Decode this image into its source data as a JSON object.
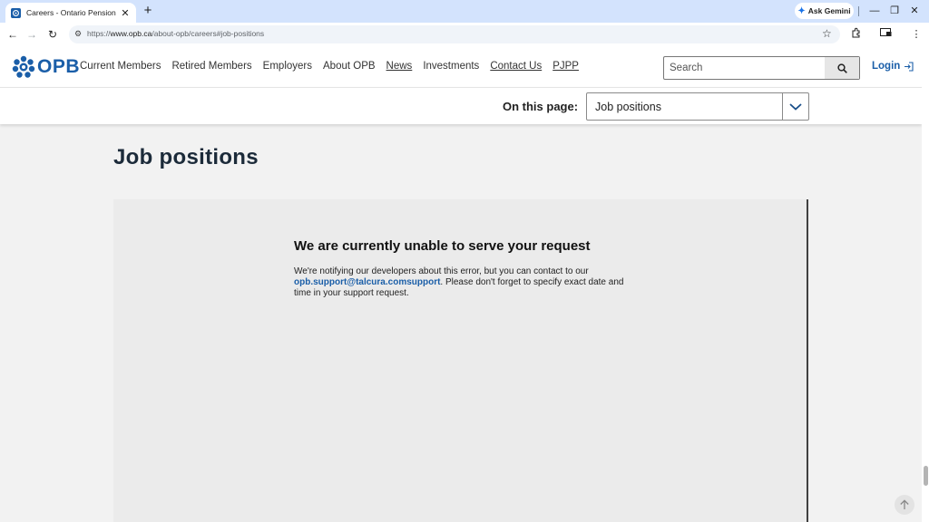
{
  "browser": {
    "tab": {
      "title": "Careers - Ontario Pension Board",
      "close": "✕"
    },
    "new_tab": "+",
    "gemini": {
      "label": "Ask Gemini"
    },
    "window": {
      "minimize": "—",
      "restore": "❐",
      "close": "✕"
    },
    "nav": {
      "back": "←",
      "forward": "→",
      "reload": "↻"
    },
    "address": {
      "url_prefix": "https://",
      "url_host": "www.opb.ca",
      "url_path": "/about-opb/careers#job-positions"
    }
  },
  "site": {
    "logo_text": "OPB",
    "nav": [
      {
        "label": "Current Members",
        "underlined": false
      },
      {
        "label": "Retired Members",
        "underlined": false
      },
      {
        "label": "Employers",
        "underlined": false
      },
      {
        "label": "About OPB",
        "underlined": false
      },
      {
        "label": "News",
        "underlined": true
      },
      {
        "label": "Investments",
        "underlined": false
      },
      {
        "label": "Contact Us",
        "underlined": true
      },
      {
        "label": "PJPP",
        "underlined": true
      }
    ],
    "search": {
      "placeholder": "Search"
    },
    "login_label": "Login"
  },
  "on_this_page": {
    "label": "On this page:",
    "selected": "Job positions"
  },
  "main": {
    "heading": "Job positions",
    "error": {
      "title": "We are currently unable to serve your request",
      "text_before": "We're notifying our developers about this error, but you can contact to our ",
      "email": "opb.support@talcura.comsupport",
      "text_after": ". Please don't forget to specify exact date and time in your support request."
    }
  },
  "colors": {
    "brand_blue": "#1a5ea8",
    "tab_strip": "#d3e3fd"
  }
}
